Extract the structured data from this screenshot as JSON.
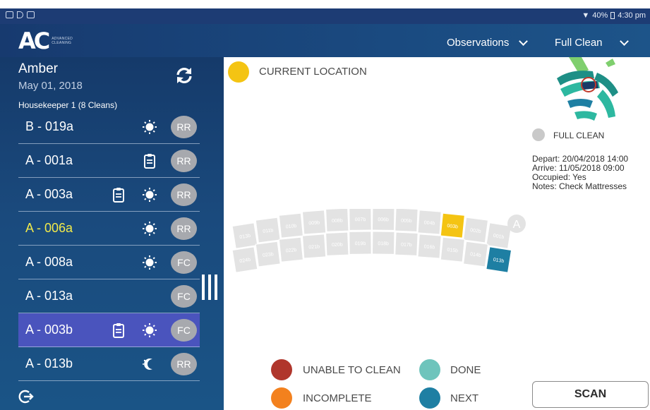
{
  "status_bar": {
    "battery": "40%",
    "time": "4:30 pm"
  },
  "app_bar": {
    "logo_text": "AC",
    "logo_sub_line1": "ADVANCED",
    "logo_sub_line2": "CLEANING",
    "dropdown_observations": "Observations",
    "dropdown_clean_type": "Full Clean"
  },
  "sidebar": {
    "user_name": "Amber",
    "date": "May 01, 2018",
    "housekeeper": "Housekeeper 1 (8 Cleans)",
    "rooms": [
      {
        "label": "B - 019a",
        "icons": [
          "sun-icon"
        ],
        "badge": "RR",
        "state": "normal"
      },
      {
        "label": "A - 001a",
        "icons": [
          "clipboard-icon"
        ],
        "badge": "RR",
        "state": "normal"
      },
      {
        "label": "A - 003a",
        "icons": [
          "clipboard-icon",
          "sun-icon"
        ],
        "badge": "RR",
        "state": "normal"
      },
      {
        "label": "A - 006a",
        "icons": [
          "sun-icon"
        ],
        "badge": "RR",
        "state": "active"
      },
      {
        "label": "A - 008a",
        "icons": [
          "sun-icon"
        ],
        "badge": "FC",
        "state": "normal"
      },
      {
        "label": "A - 013a",
        "icons": [],
        "badge": "FC",
        "state": "normal"
      },
      {
        "label": "A - 003b",
        "icons": [
          "clipboard-icon",
          "sun-icon"
        ],
        "badge": "FC",
        "state": "selected"
      },
      {
        "label": "A - 013b",
        "icons": [
          "moon-icon"
        ],
        "badge": "RR",
        "state": "normal"
      }
    ]
  },
  "main": {
    "current_location_label": "CURRENT LOCATION",
    "full_clean_label": "FULL CLEAN",
    "details": {
      "depart": "Depart: 20/04/2018 14:00",
      "arrive": "Arrive: 11/05/2018 09:00",
      "occupied": "Occupied: Yes",
      "notes": "Notes: Check Mattresses"
    },
    "section_marker": "A",
    "seats_top_row": [
      "013b",
      "011b",
      "010b",
      "009b",
      "008b",
      "007b",
      "006b",
      "005b",
      "004b",
      "003b",
      "002b",
      "001b"
    ],
    "seats_bottom_row": [
      "024b",
      "023b",
      "022b",
      "021b",
      "020b",
      "019b",
      "018b",
      "017b",
      "016b",
      "015b",
      "014b",
      "013b"
    ],
    "current_seat": "003b",
    "next_seat": "013b",
    "legend": {
      "unable_to_clean": "UNABLE TO CLEAN",
      "incomplete": "INCOMPLETE",
      "done": "DONE",
      "next": "NEXT"
    },
    "scan_button": "SCAN"
  },
  "colors": {
    "current": "#f4c413",
    "next": "#1e7fa3",
    "done": "#6ec4bc",
    "unable": "#b0362c",
    "incomplete": "#f3811e",
    "seat": "#e3e3e3",
    "selected_row": "#4a54bd",
    "active_text": "#f2ea4a"
  }
}
